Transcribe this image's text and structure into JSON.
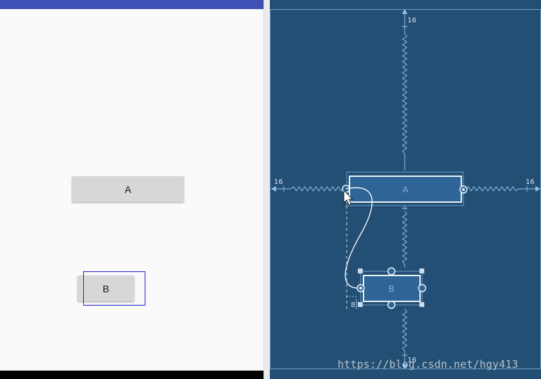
{
  "preview": {
    "button_a_label": "A",
    "button_b_label": "B"
  },
  "blueprint": {
    "widget_a_label": "A",
    "widget_b_label": "B",
    "margin_top": "16",
    "margin_left": "16",
    "margin_right": "16",
    "margin_bottom": "16",
    "margin_b_left": "8"
  },
  "watermark": "https://blog.csdn.net/hgy413",
  "colors": {
    "app_bar": "#3f51b5",
    "blueprint_bg": "#244f74",
    "blueprint_line": "#8fc0ea",
    "selection_outline": "#2020c8"
  }
}
